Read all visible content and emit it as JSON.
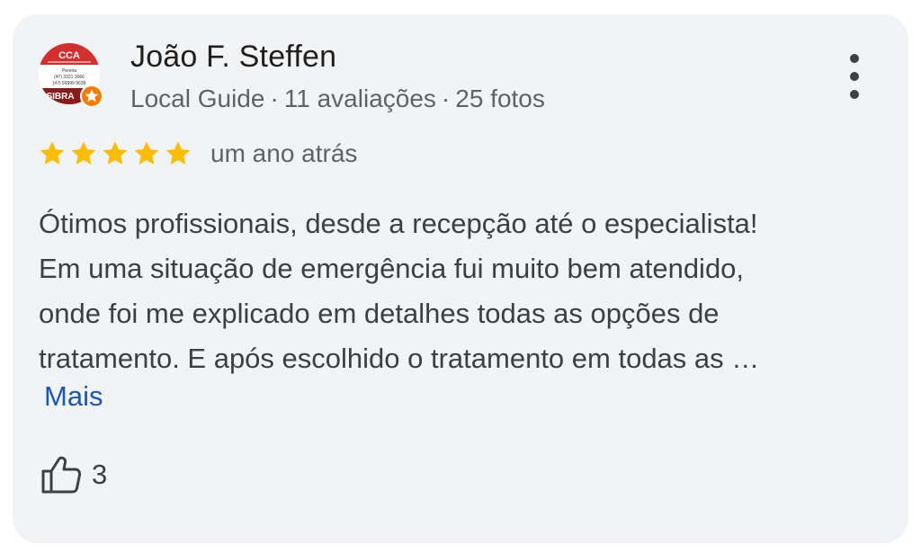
{
  "review": {
    "author": {
      "name": "João F. Steffen",
      "badge": "Local Guide",
      "reviews_count": "11 avaliações",
      "photos_count": "25 fotos",
      "separator": "·",
      "avatar_icon": "cca-sibra-logo-avatar",
      "avatar_text": {
        "top": "CCA",
        "line1": "Pereira",
        "line2": "(47) 3321 3066",
        "line3": "(47) 99999 9638",
        "brand": "SIBRA"
      },
      "local_guide_badge_icon": "star-badge-icon"
    },
    "rating": 5,
    "max_rating": 5,
    "date": "um ano atrás",
    "text_lines": [
      "Ótimos profissionais, desde a recepção até o especialista!",
      "Em uma situação de emergência fui muito bem atendido,",
      "onde foi me explicado em detalhes todas as opções de",
      "tratamento. E após escolhido o tratamento em todas as …"
    ],
    "more_label": "Mais",
    "likes": "3",
    "like_icon": "thumbs-up-icon",
    "menu_icon": "more-vert-icon"
  },
  "colors": {
    "card_background": "#f2f3f5",
    "star": "#fbbc04",
    "link": "#1a57b8",
    "primary_text": "#1f1f1f",
    "secondary_text": "#5f6368",
    "avatar_red": "#d32f2f",
    "badge_orange": "#f57c00"
  }
}
